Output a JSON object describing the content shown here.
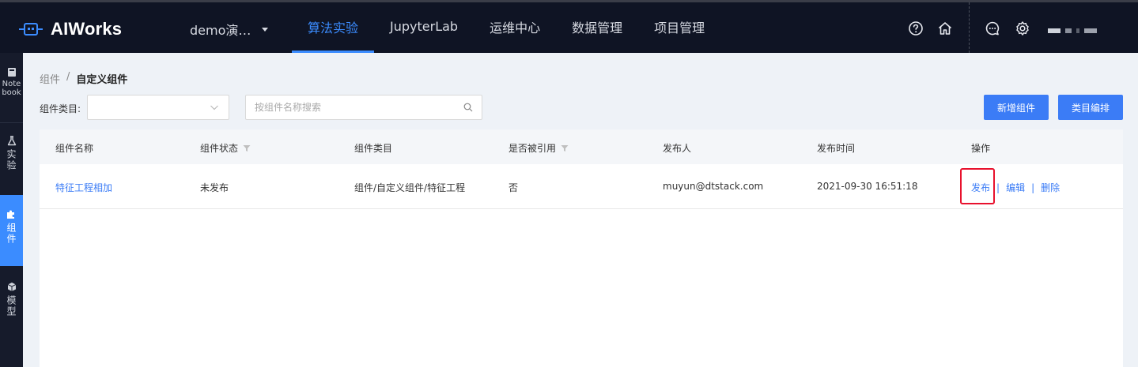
{
  "app": {
    "name": "AIWorks",
    "project_selector": "demo演…",
    "nav": [
      "算法实验",
      "JupyterLab",
      "运维中心",
      "数据管理",
      "项目管理"
    ],
    "active_nav": "算法实验",
    "accent_color": "#3b8cff",
    "icons": [
      "help-circle-icon",
      "home-icon",
      "chat-icon",
      "settings-gear-icon"
    ]
  },
  "sidebar": {
    "items": [
      {
        "label": "Note book",
        "icon": "notebook-icon"
      },
      {
        "label": "实验",
        "icon": "flask-icon"
      },
      {
        "label": "组件",
        "icon": "puzzle-icon",
        "active": true
      },
      {
        "label": "模型",
        "icon": "cube-icon"
      }
    ]
  },
  "breadcrumb": {
    "parent": "组件",
    "separator": "/",
    "current": "自定义组件"
  },
  "filters": {
    "category_label": "组件类目:",
    "category_value": "",
    "search_placeholder": "按组件名称搜索"
  },
  "buttons": {
    "add_component": "新增组件",
    "edit_category": "类目编排"
  },
  "table": {
    "columns": [
      "组件名称",
      "组件状态",
      "组件类目",
      "是否被引用",
      "发布人",
      "发布时间",
      "操作"
    ],
    "rows": [
      {
        "name": "特征工程相加",
        "status": "未发布",
        "category": "组件/自定义组件/特征工程",
        "referenced": "否",
        "publisher": "muyun@dtstack.com",
        "publish_time": "2021-09-30 16:51:18",
        "actions": [
          "发布",
          "编辑",
          "删除"
        ]
      }
    ],
    "highlight_color": "#e8112d"
  }
}
